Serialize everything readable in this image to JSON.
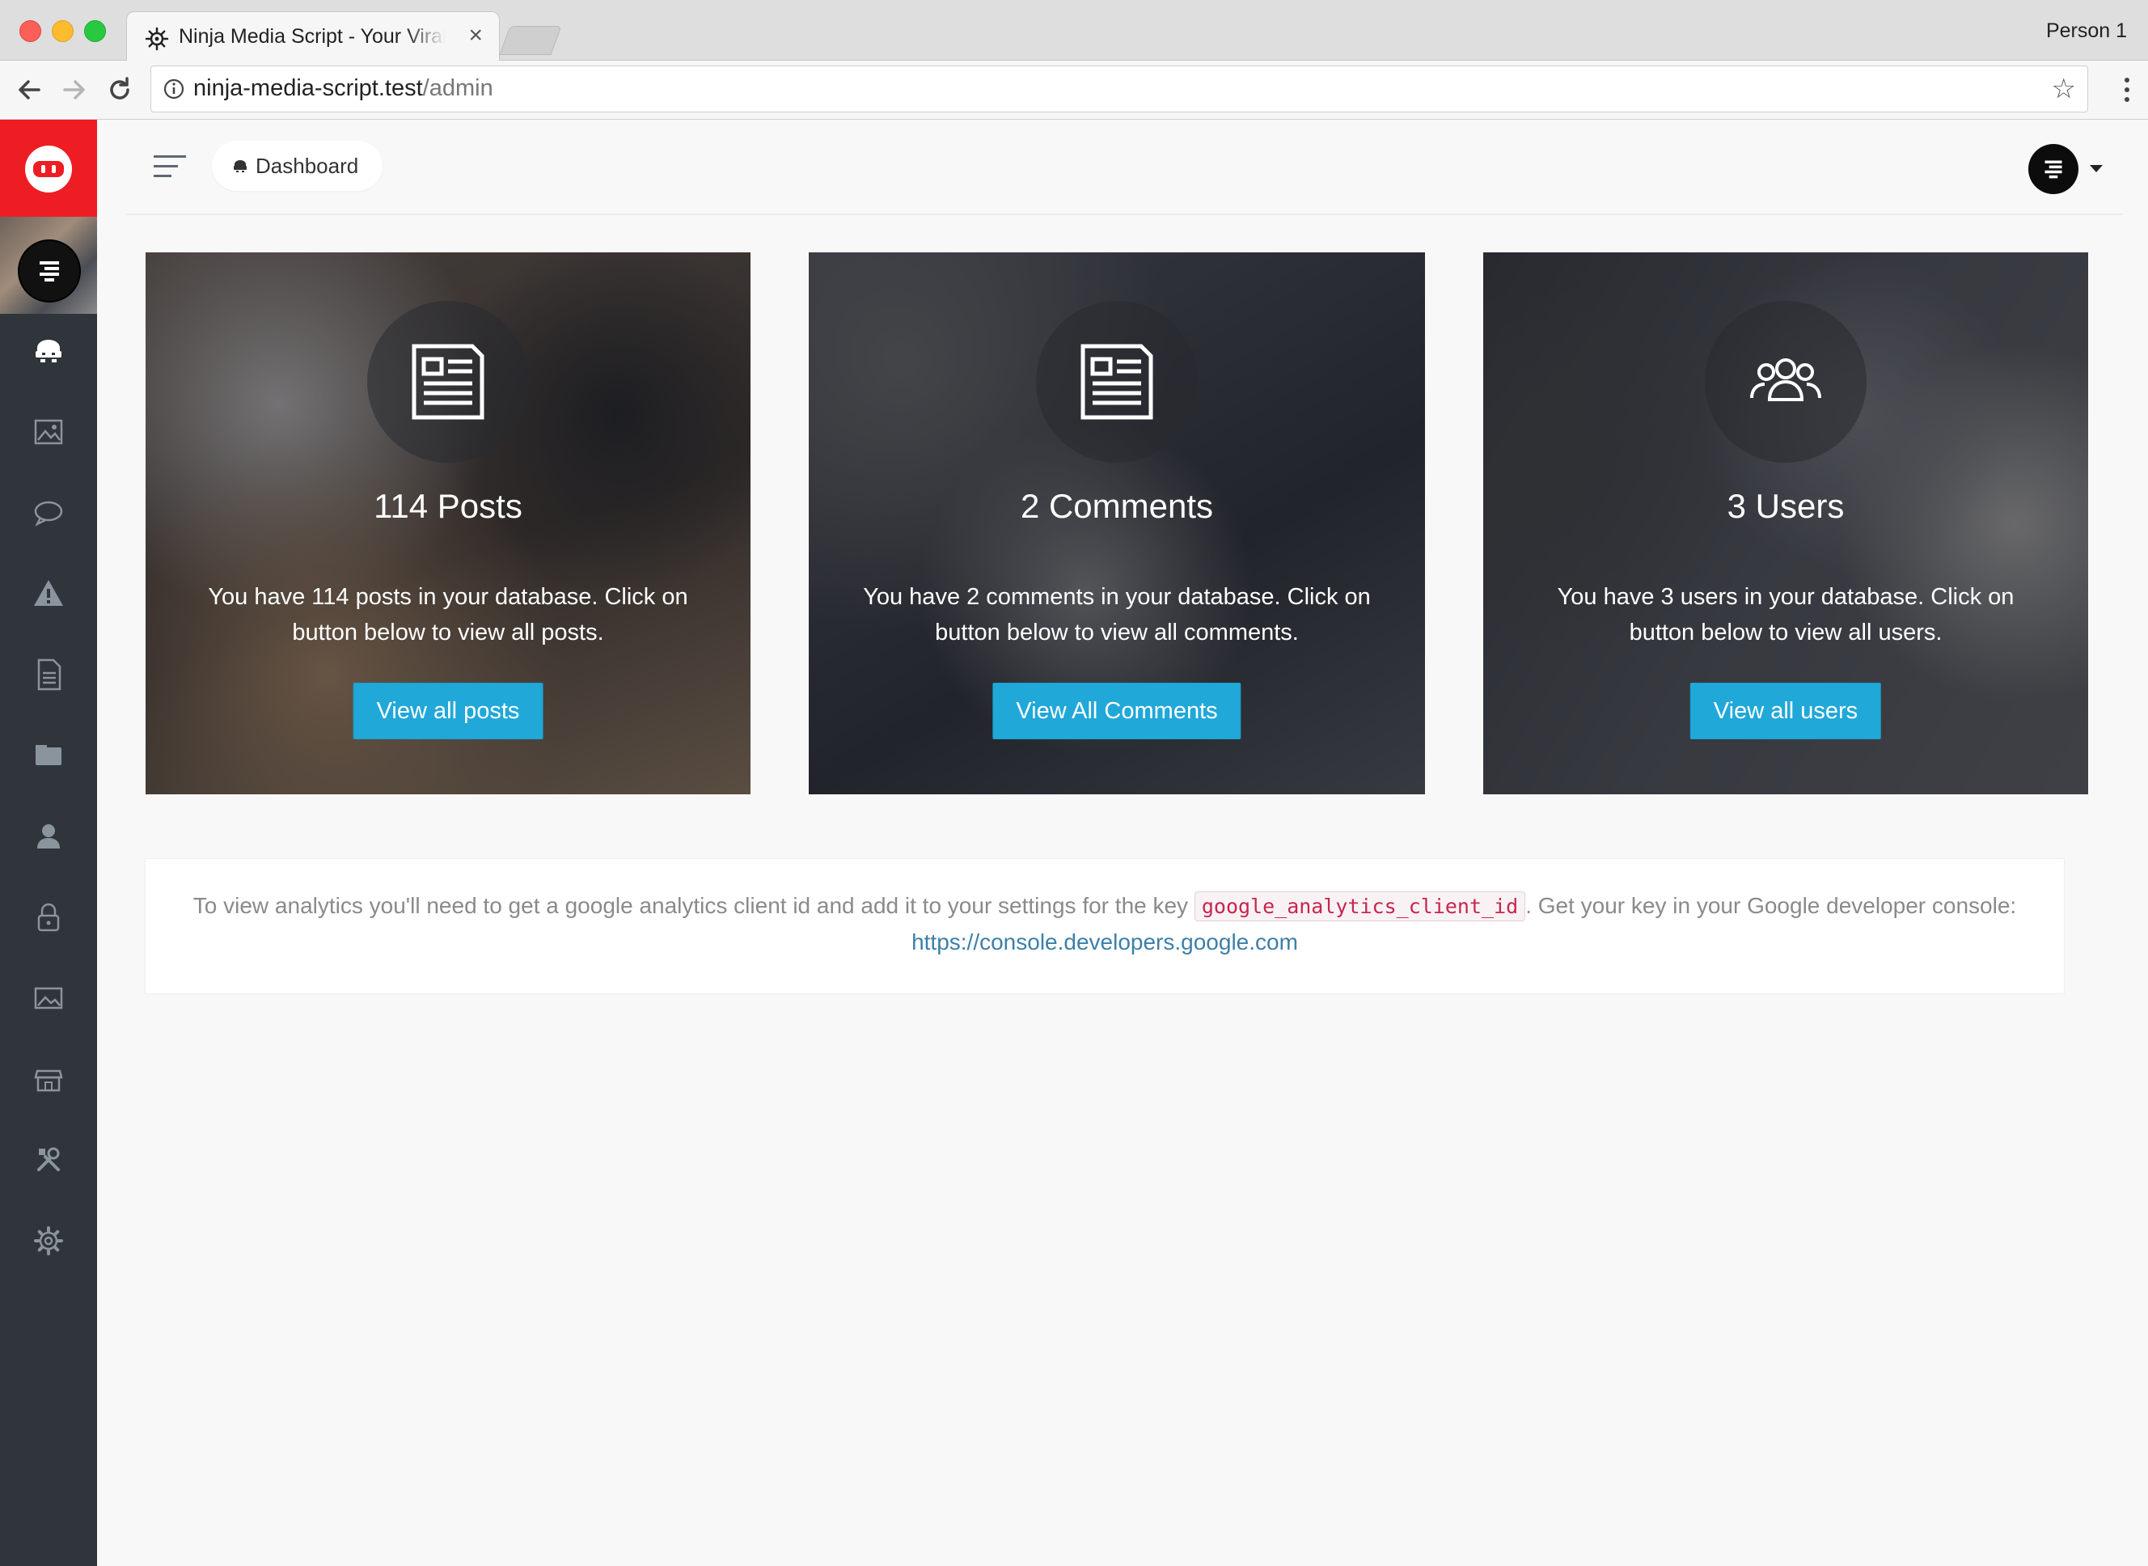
{
  "browser": {
    "tab_title": "Ninja Media Script - Your Viral",
    "tab_close": "×",
    "profile_name": "Person 1",
    "url_host": "ninja-media-script.test",
    "url_path": "/admin",
    "star": "☆"
  },
  "topbar": {
    "breadcrumb": "Dashboard"
  },
  "sidebar": {
    "items": [
      {
        "icon": "dashboard-icon"
      },
      {
        "icon": "posts-image-icon"
      },
      {
        "icon": "comments-icon"
      },
      {
        "icon": "reports-warning-icon"
      },
      {
        "icon": "pages-document-icon"
      },
      {
        "icon": "categories-folder-icon"
      },
      {
        "icon": "users-icon"
      },
      {
        "icon": "roles-lock-icon"
      },
      {
        "icon": "media-icon"
      },
      {
        "icon": "plugins-store-icon"
      },
      {
        "icon": "tools-icon"
      },
      {
        "icon": "settings-gear-icon"
      }
    ]
  },
  "cards": {
    "posts": {
      "title": "114 Posts",
      "description": "You have 114 posts in your database. Click on button below to view all posts.",
      "button": "View all posts"
    },
    "comments": {
      "title": "2 Comments",
      "description": "You have 2 comments in your database. Click on button below to view all comments.",
      "button": "View All Comments"
    },
    "users": {
      "title": "3 Users",
      "description": "You have 3 users in your database. Click on button below to view all users.",
      "button": "View all users"
    }
  },
  "analytics_note": {
    "text_before": "To view analytics you'll need to get a google analytics client id and add it to your settings for the key",
    "key": "google_analytics_client_id",
    "text_after": ". Get your key in your Google developer console:",
    "link": "https://console.developers.google.com"
  },
  "colors": {
    "brand_red": "#ee1d23",
    "sidebar_bg": "#2f353a",
    "button_blue": "#20a8d8",
    "code_red": "#c7254e"
  }
}
